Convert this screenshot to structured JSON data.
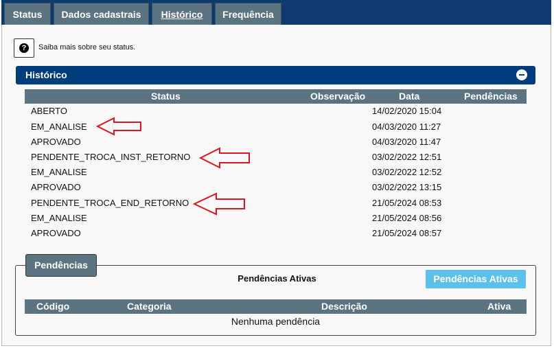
{
  "tabs": [
    {
      "label": "Status"
    },
    {
      "label": "Dados cadastrais"
    },
    {
      "label": "Histórico"
    },
    {
      "label": "Frequência"
    }
  ],
  "info": {
    "icon": "question-icon",
    "text": "Saiba mais sobre seu status."
  },
  "historico": {
    "title": "Histórico",
    "collapse_icon": "minus-circle-icon",
    "columns": [
      "Status",
      "Observação",
      "Data",
      "Pendências"
    ],
    "rows": [
      {
        "status": "ABERTO",
        "observacao": "",
        "data": "14/02/2020 15:04",
        "pendencias": ""
      },
      {
        "status": "EM_ANALISE",
        "observacao": "",
        "data": "04/03/2020 11:27",
        "pendencias": ""
      },
      {
        "status": "APROVADO",
        "observacao": "",
        "data": "04/03/2020 11:47",
        "pendencias": ""
      },
      {
        "status": "PENDENTE_TROCA_INST_RETORNO",
        "observacao": "",
        "data": "03/02/2022 12:51",
        "pendencias": ""
      },
      {
        "status": "EM_ANALISE",
        "observacao": "",
        "data": "03/02/2022 12:52",
        "pendencias": ""
      },
      {
        "status": "APROVADO",
        "observacao": "",
        "data": "03/02/2022 13:15",
        "pendencias": ""
      },
      {
        "status": "PENDENTE_TROCA_END_RETORNO",
        "observacao": "",
        "data": "21/05/2024 08:53",
        "pendencias": ""
      },
      {
        "status": "EM_ANALISE",
        "observacao": "",
        "data": "21/05/2024 08:56",
        "pendencias": ""
      },
      {
        "status": "APROVADO",
        "observacao": "",
        "data": "21/05/2024 08:57",
        "pendencias": ""
      }
    ],
    "annotation_color": "#e0141e"
  },
  "pendencias": {
    "legend": "Pendências",
    "title": "Pendências Ativas",
    "button_label": "Pendências Ativas",
    "columns": [
      "Código",
      "Categoria",
      "Descrição",
      "Ativa"
    ],
    "empty_text": "Nenhuma pendência"
  },
  "colors": {
    "tabbar": "#0e3a6f",
    "tab": "#5c7381",
    "section_bar": "#003d7d",
    "button": "#5bc0ea"
  }
}
